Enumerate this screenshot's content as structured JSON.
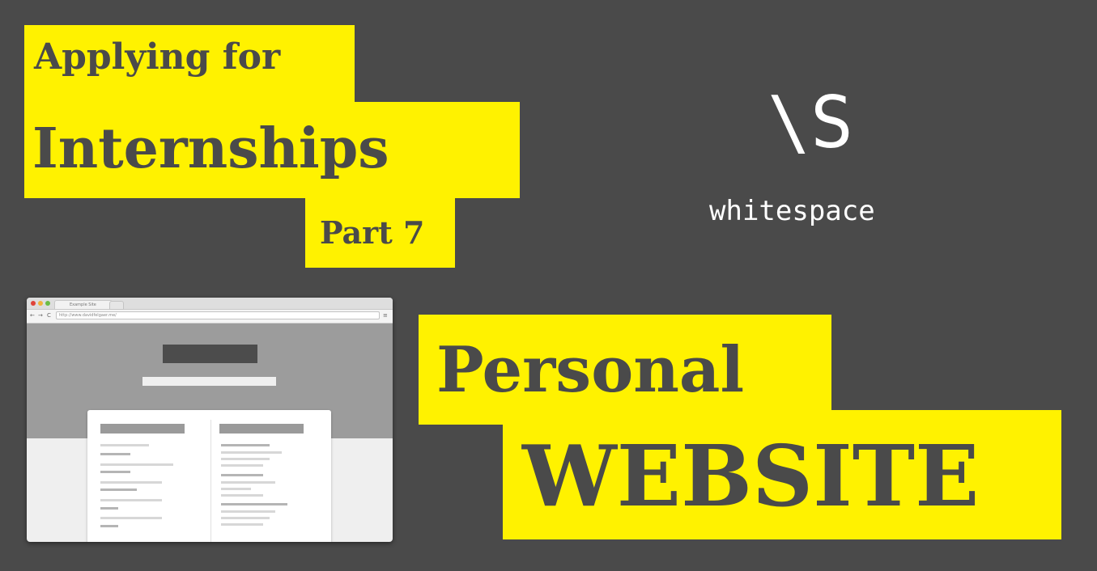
{
  "headline": {
    "line1": "Applying for",
    "line2": "Internships",
    "line3": "Part 7"
  },
  "logo": {
    "mark": "\\S",
    "name": "whitespace"
  },
  "topic": {
    "line1": "Personal",
    "line2": "WEBSITE"
  },
  "browser_mockup": {
    "tab_label": "Example Site",
    "url": "http://www.davidfelgaer.me/",
    "nav_back": "←",
    "nav_forward": "→",
    "nav_reload": "C",
    "menu_icon": "≡"
  },
  "colors": {
    "background": "#4a4a4a",
    "accent_yellow": "#fff200",
    "text_dark": "#4a4a4a",
    "logo_white": "#ffffff"
  }
}
